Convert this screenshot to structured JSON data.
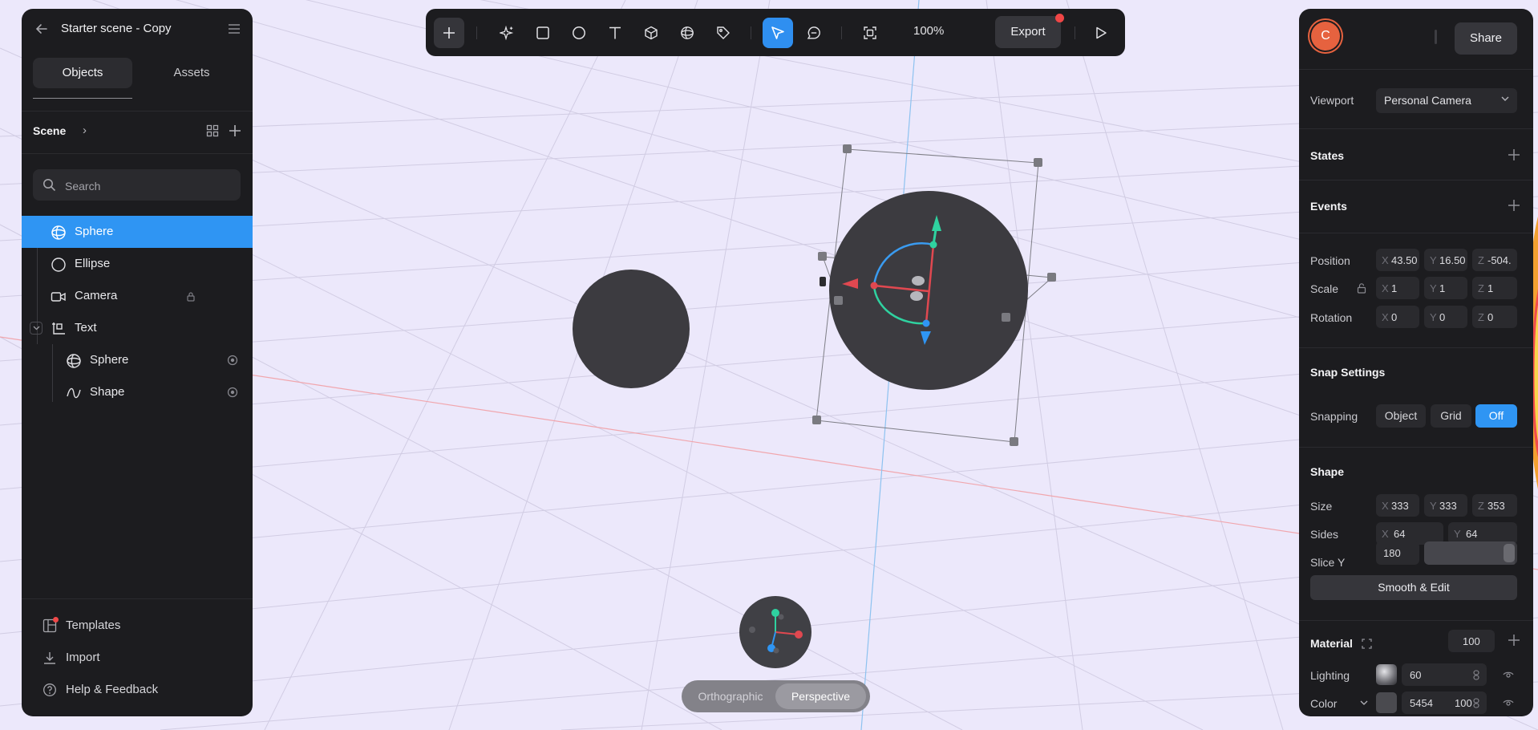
{
  "project": {
    "title": "Starter scene - Copy"
  },
  "left_tabs": {
    "objects": "Objects",
    "assets": "Assets"
  },
  "scene": {
    "label": "Scene"
  },
  "search": {
    "placeholder": "Search"
  },
  "tree": [
    {
      "label": "Sphere",
      "icon": "sphere-icon",
      "selected": true
    },
    {
      "label": "Ellipse",
      "icon": "circle-icon"
    },
    {
      "label": "Camera",
      "icon": "camera-icon",
      "right_icon": "lock-icon"
    },
    {
      "label": "Text",
      "icon": "group-icon",
      "expanded": true
    },
    {
      "label": "Sphere",
      "icon": "sphere-icon",
      "right_icon": "target-icon"
    },
    {
      "label": "Shape",
      "icon": "curve-icon",
      "right_icon": "target-icon"
    }
  ],
  "footer": {
    "templates": "Templates",
    "import": "Import",
    "help": "Help & Feedback"
  },
  "toolbar": {
    "zoom": "100%",
    "export": "Export"
  },
  "user": {
    "avatar_initial": "C"
  },
  "right": {
    "share": "Share",
    "viewport_label": "Viewport",
    "viewport_value": "Personal Camera",
    "states": "States",
    "events": "Events",
    "position_label": "Position",
    "position": {
      "x": "43.50",
      "y": "16.50",
      "z": "-504."
    },
    "scale_label": "Scale",
    "scale": {
      "x": "1",
      "y": "1",
      "z": "1"
    },
    "rotation_label": "Rotation",
    "rotation": {
      "x": "0",
      "y": "0",
      "z": "0"
    },
    "snap_heading": "Snap Settings",
    "snapping_label": "Snapping",
    "snap_options": {
      "object": "Object",
      "grid": "Grid",
      "off": "Off"
    },
    "shape_heading": "Shape",
    "size_label": "Size",
    "size": {
      "x": "333",
      "y": "333",
      "z": "353"
    },
    "sides_label": "Sides",
    "sides": {
      "x": "64",
      "y": "64"
    },
    "slice_label": "Slice Y",
    "slice_value": "180",
    "slice_fraction": 1.0,
    "smooth_edit": "Smooth & Edit",
    "material_heading": "Material",
    "material_value": "100",
    "lighting_label": "Lighting",
    "lighting_value": "60",
    "color_label": "Color",
    "color_value": "5454",
    "color_opacity": "100",
    "color_swatch": "#4a4a4f"
  },
  "view_toggle": {
    "ortho": "Orthographic",
    "persp": "Perspective"
  },
  "axis_labels": {
    "x": "X",
    "y": "Y",
    "z": "Z"
  },
  "colors": {
    "accent": "#2f95f3",
    "panel": "#1c1c1f",
    "canvas": "#ece8fb",
    "notify": "#f04646"
  }
}
